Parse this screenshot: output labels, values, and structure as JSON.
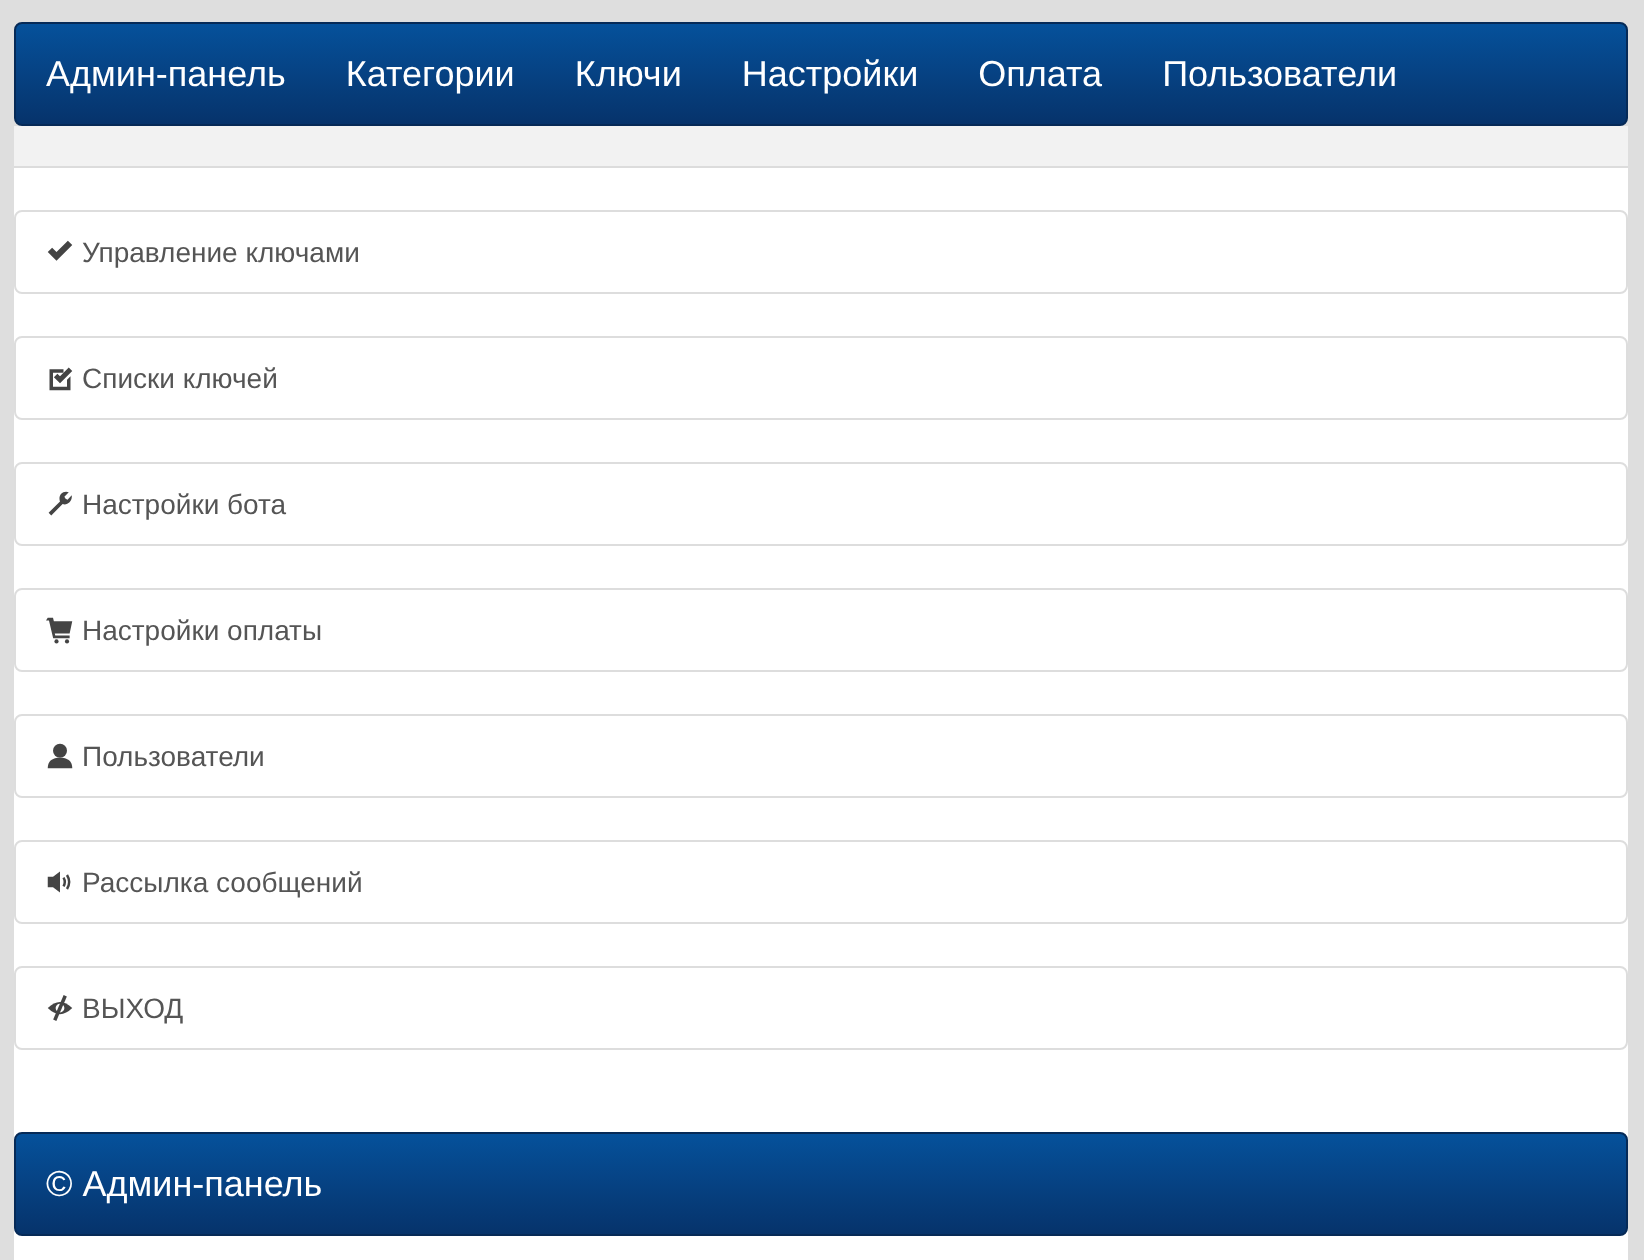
{
  "navbar": {
    "brand": "Админ-панель",
    "links": [
      "Категории",
      "Ключи",
      "Настройки",
      "Оплата",
      "Пользователи"
    ]
  },
  "menu": [
    {
      "kind": "check",
      "label": "Управление ключами"
    },
    {
      "kind": "checkbox",
      "label": "Списки ключей"
    },
    {
      "kind": "wrench",
      "label": "Настройки бота"
    },
    {
      "kind": "cart",
      "label": "Настройки оплаты"
    },
    {
      "kind": "user",
      "label": "Пользователи"
    },
    {
      "kind": "speaker",
      "label": "Рассылка сообщений"
    },
    {
      "kind": "eye",
      "label": "ВЫХОД"
    }
  ],
  "footer": {
    "text": "© Админ-панель"
  }
}
